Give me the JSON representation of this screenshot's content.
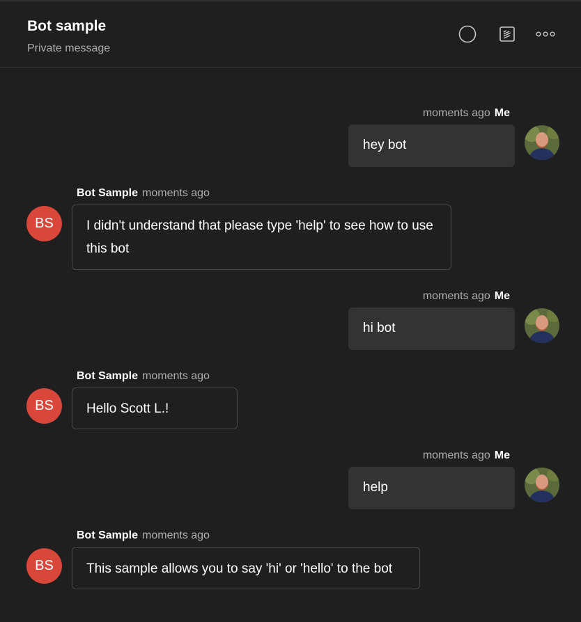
{
  "header": {
    "title": "Bot sample",
    "subtitle": "Private message",
    "icons": [
      "status-circle-icon",
      "notes-icon",
      "more-options-icon"
    ]
  },
  "messages": [
    {
      "sender": "Me",
      "time": "moments ago",
      "text": "hey bot"
    },
    {
      "sender": "Bot Sample",
      "time": "moments ago",
      "text": "I didn't understand that please type 'help' to see how to use this bot",
      "avatar_initials": "BS"
    },
    {
      "sender": "Me",
      "time": "moments ago",
      "text": "hi bot"
    },
    {
      "sender": "Bot Sample",
      "time": "moments ago",
      "text": "Hello Scott L.!",
      "avatar_initials": "BS"
    },
    {
      "sender": "Me",
      "time": "moments ago",
      "text": "help"
    },
    {
      "sender": "Bot Sample",
      "time": "moments ago",
      "text": "This sample allows you to say 'hi' or 'hello' to the bot",
      "avatar_initials": "BS"
    }
  ],
  "colors": {
    "background": "#1f1f1f",
    "bot_avatar": "#d9473b",
    "my_bubble": "#333333",
    "bot_bubble_border": "#4a4a4a"
  }
}
